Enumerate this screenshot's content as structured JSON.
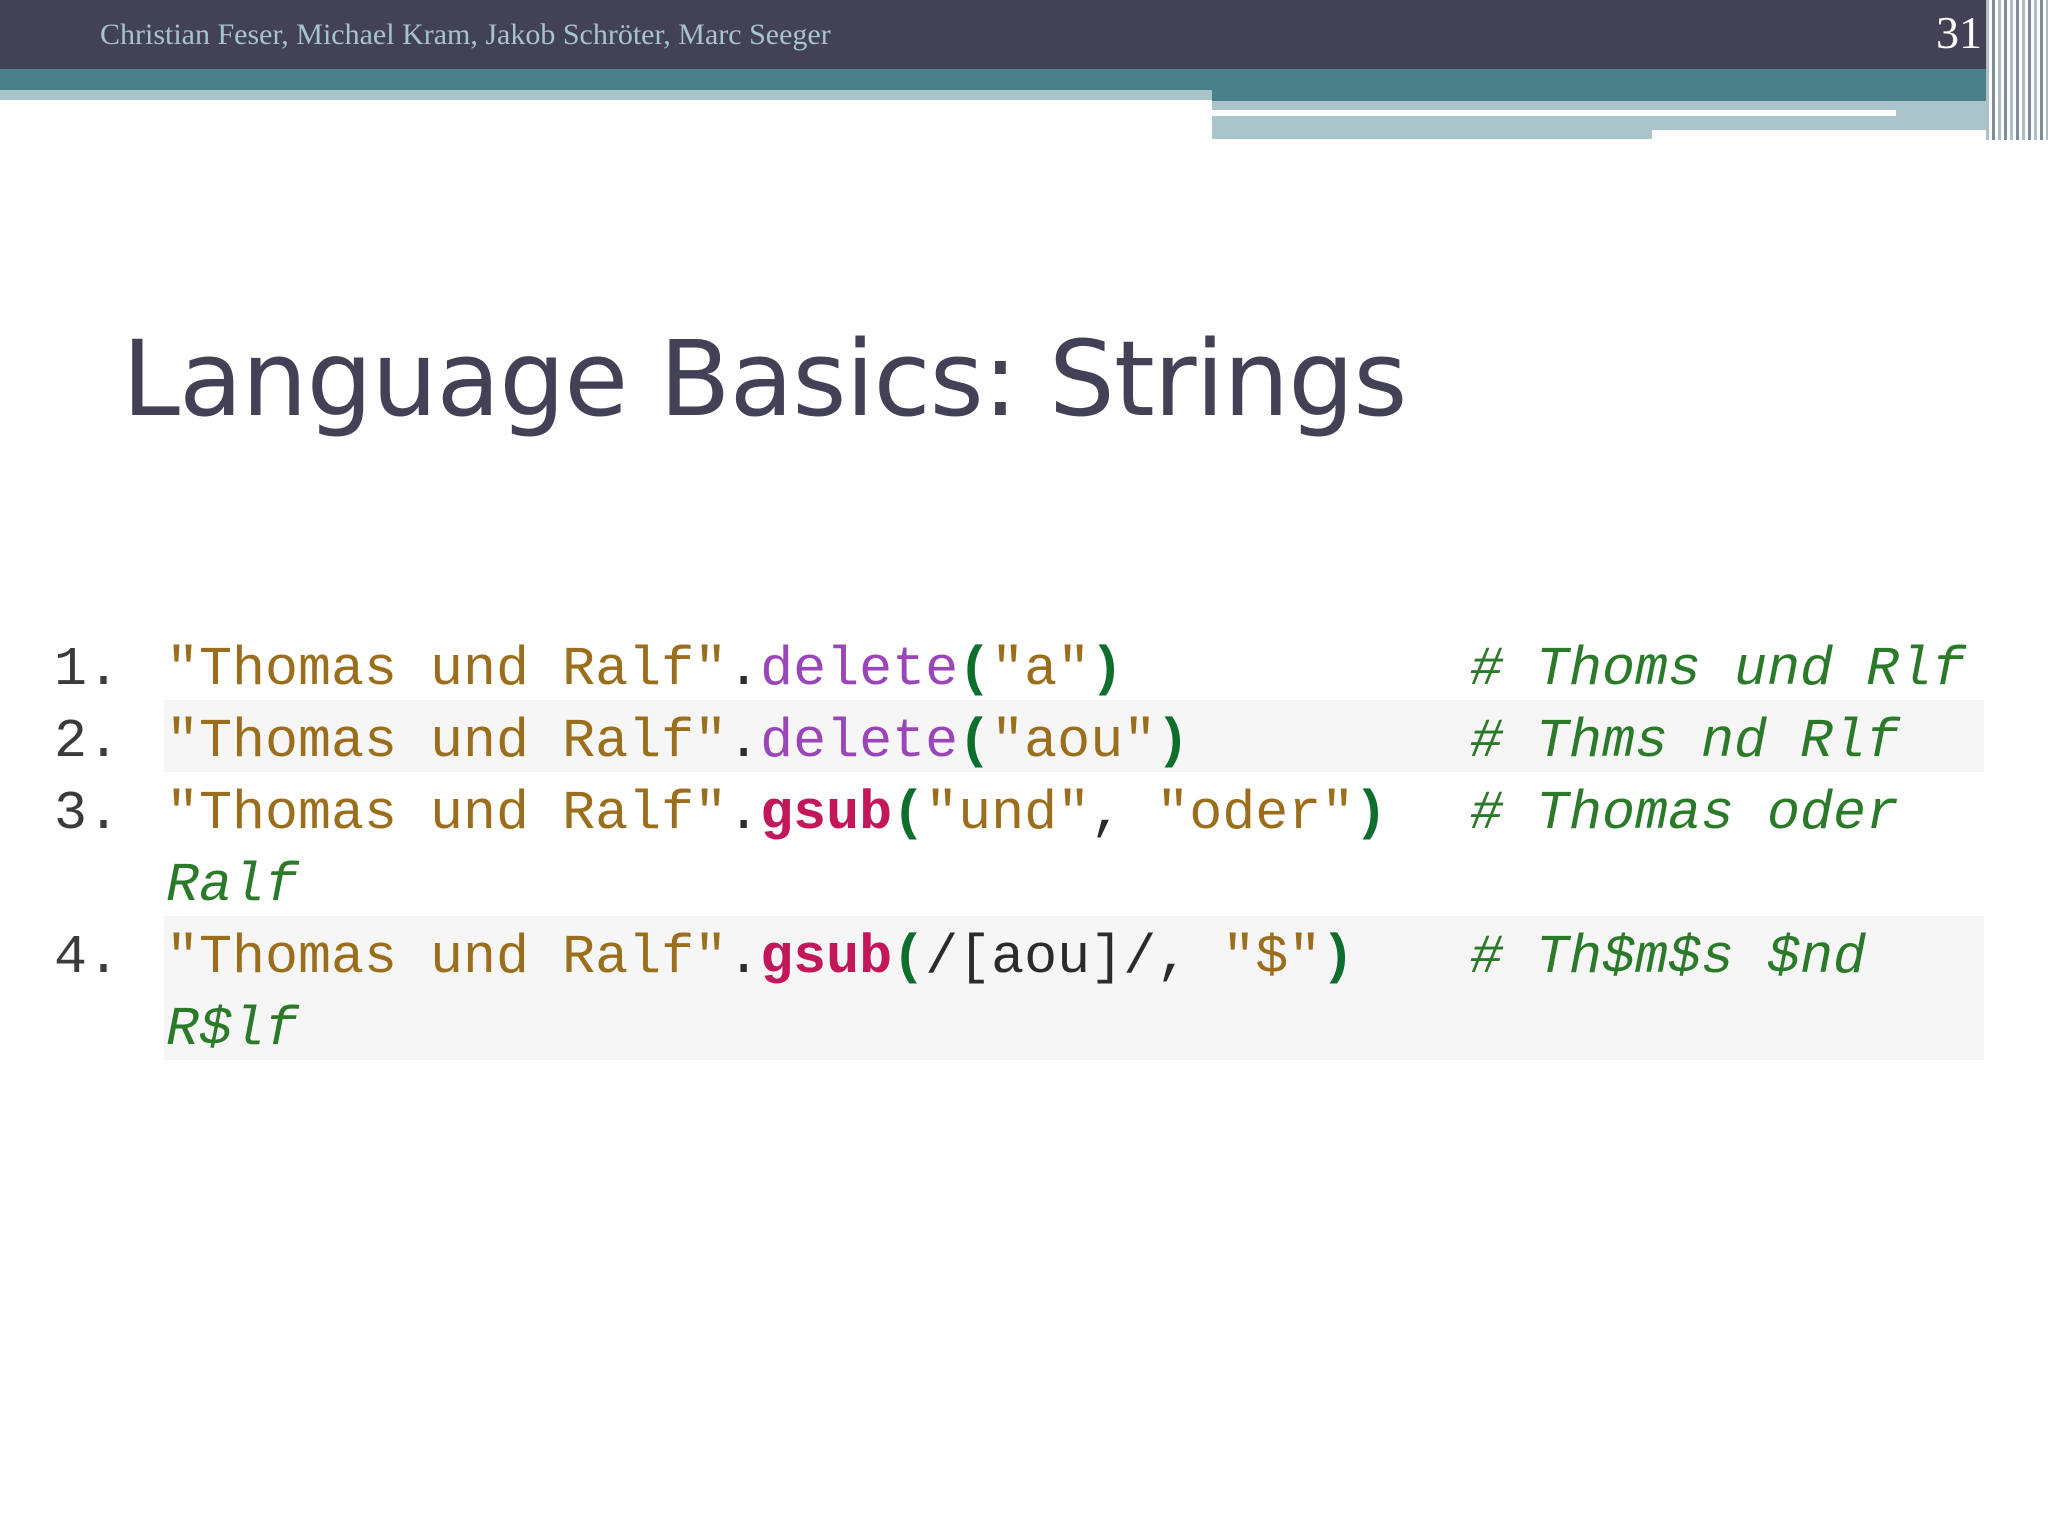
{
  "header": {
    "authors": "Christian Feser, Michael Kram, Jakob Schröter, Marc Seeger",
    "page_number": "31"
  },
  "slide": {
    "title": "Language Basics: Strings"
  },
  "code": {
    "lines": [
      {
        "num": "1.",
        "str": "\"Thomas und Ralf\"",
        "dot": ".",
        "method": "delete",
        "open": "(",
        "arg1": "\"a\"",
        "close": ")",
        "comment": "# Thoms und Rlf"
      },
      {
        "num": "2.",
        "str": "\"Thomas und Ralf\"",
        "dot": ".",
        "method": "delete",
        "open": "(",
        "arg1": "\"aou\"",
        "close": ")",
        "comment": "# Thms nd Rlf"
      },
      {
        "num": "3.",
        "str": "\"Thomas und Ralf\"",
        "dot": ".",
        "method": "gsub",
        "open": "(",
        "arg1": "\"und\"",
        "comma": ", ",
        "arg2": "\"oder\"",
        "close": ")",
        "comment": "# Thomas oder",
        "comment_cont": "Ralf"
      },
      {
        "num": "4.",
        "str": "\"Thomas und Ralf\"",
        "dot": ".",
        "method": "gsub",
        "open": "(",
        "regex_open": "/[",
        "regex_body": "aou",
        "regex_close": "]/",
        "comma": ", ",
        "arg2": "\"$\"",
        "close": ")",
        "comment": "# Th$m$s $nd",
        "comment_cont": "R$lf"
      }
    ]
  }
}
